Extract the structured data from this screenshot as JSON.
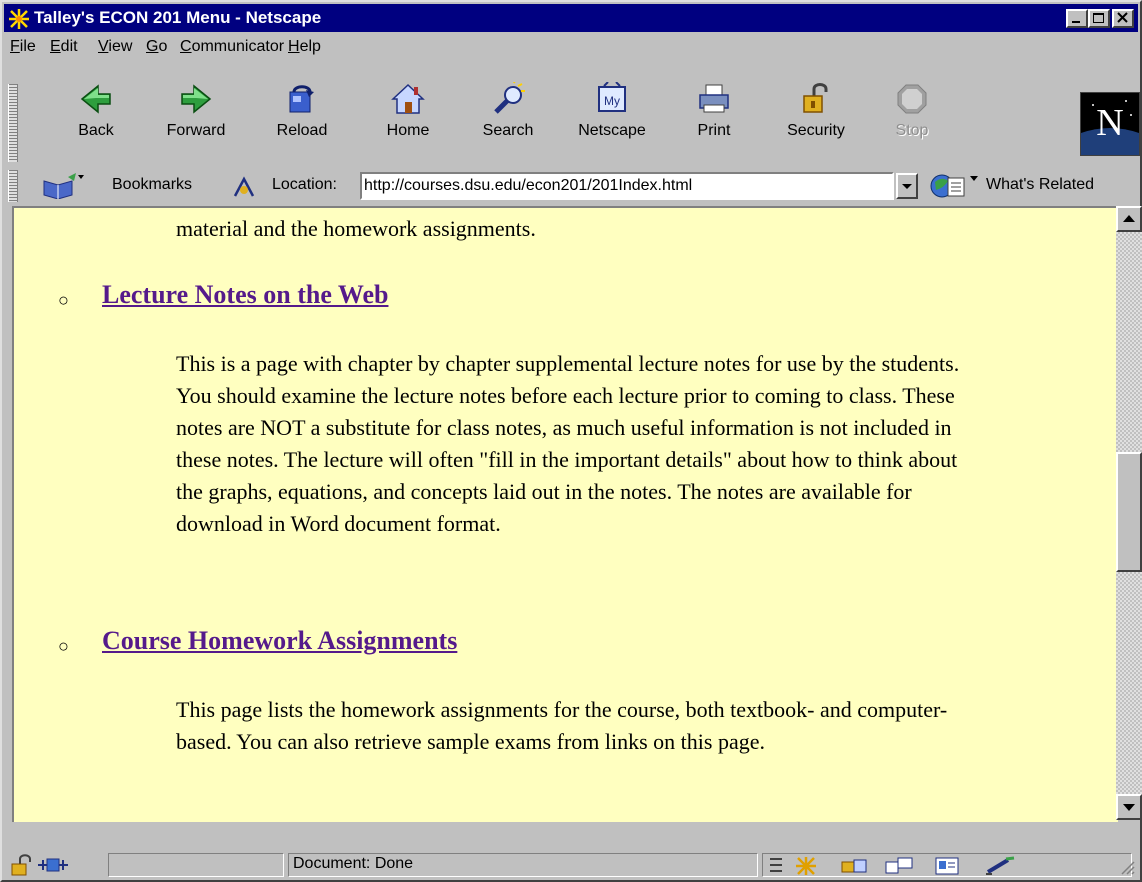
{
  "window": {
    "title": "Talley's ECON 201 Menu - Netscape"
  },
  "menubar": {
    "items": [
      "File",
      "Edit",
      "View",
      "Go",
      "Communicator",
      "Help"
    ]
  },
  "toolbar": {
    "buttons": [
      {
        "label": "Back",
        "icon": "back-arrow-icon"
      },
      {
        "label": "Forward",
        "icon": "forward-arrow-icon"
      },
      {
        "label": "Reload",
        "icon": "reload-icon"
      },
      {
        "label": "Home",
        "icon": "home-icon"
      },
      {
        "label": "Search",
        "icon": "search-icon"
      },
      {
        "label": "Netscape",
        "icon": "my-netscape-icon"
      },
      {
        "label": "Print",
        "icon": "printer-icon"
      },
      {
        "label": "Security",
        "icon": "padlock-icon"
      },
      {
        "label": "Stop",
        "icon": "stop-icon",
        "disabled": true
      }
    ],
    "logo_letter": "N"
  },
  "location_bar": {
    "bookmarks_label": "Bookmarks",
    "location_label": "Location:",
    "url": "http://courses.dsu.edu/econ201/201Index.html",
    "whats_related_label": "What's Related"
  },
  "content": {
    "intro_tail": "material and the homework assignments.",
    "sections": [
      {
        "link": "Lecture Notes on the Web",
        "description": "This is a page with chapter by chapter supplemental lecture notes for use by the students. You should examine the lecture notes before each lecture prior to coming to class. These notes are NOT a substitute for class notes, as much useful information is not included in these notes. The lecture will often \"fill in the important details\" about how to think about the graphs, equations, and concepts laid out in the notes. The notes are available for download in Word document format."
      },
      {
        "link": "Course Homework Assignments",
        "description": "This page lists the homework assignments for the course, both textbook- and computer-based.  You can also retrieve sample exams from links on this page."
      }
    ]
  },
  "status": {
    "text": "Document: Done"
  },
  "colors": {
    "titlebar": "#000080",
    "page_background": "#ffffc0",
    "visited_link": "#551a8b"
  }
}
